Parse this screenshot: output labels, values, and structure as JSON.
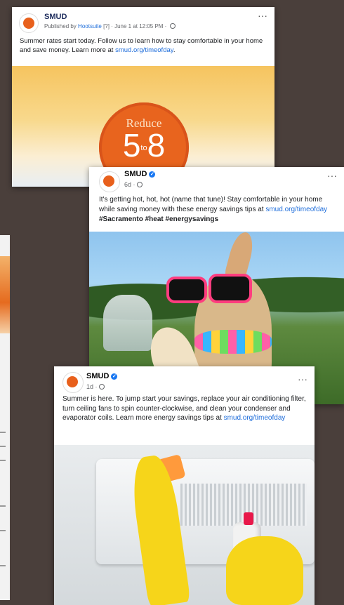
{
  "post1": {
    "page_name": "SMUD",
    "published_by_prefix": "Published by",
    "published_by_name": "Hootsuite",
    "published_by_suffix": "[?] · June 1 at 12:05 PM ·",
    "text": "Summer rates start today. Follow us to learn how to stay comfortable in your home and save money. Learn more at ",
    "link": "smud.org/timeofday",
    "text_end": ".",
    "graphic_top": "Reduce",
    "graphic_left": "5",
    "graphic_mid": "to",
    "graphic_right": "8",
    "more_icon": "ellipsis-icon"
  },
  "post2": {
    "page_name": "SMUD",
    "time": "6d ·",
    "text": "It's getting hot, hot, hot (name that tune)!  Stay comfortable in your home while saving money with these energy savings tips at ",
    "link": "smud.org/timeofday",
    "hashtags": " #Sacramento #heat #energysavings",
    "image_desc_icon": "dog-photo",
    "more_icon": "ellipsis-icon"
  },
  "post3": {
    "page_name": "SMUD",
    "time": "1d ·",
    "text": "Summer is here.  To jump start your savings, replace your air conditioning filter, turn ceiling fans to spin counter-clockwise, and clean your condenser and evaporator coils.  Learn more energy savings tips at ",
    "link": "smud.org/timeofday",
    "image_desc_icon": "ac-cleaning-photo",
    "more_icon": "ellipsis-icon"
  },
  "colors": {
    "background": "#4a3f3b",
    "brand_orange": "#e8601c",
    "link_blue": "#216fdb"
  }
}
